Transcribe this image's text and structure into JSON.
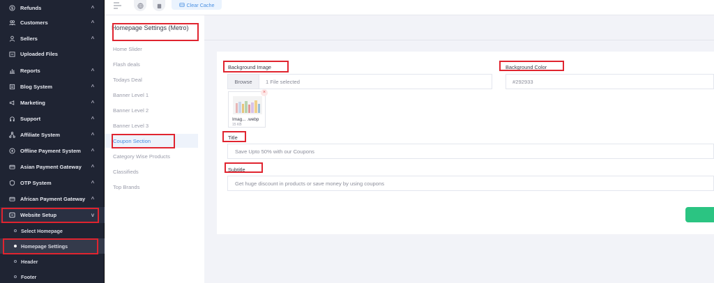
{
  "sidebar": {
    "items": [
      {
        "label": "Refunds",
        "icon": "refund-icon"
      },
      {
        "label": "Customers",
        "icon": "customers-icon"
      },
      {
        "label": "Sellers",
        "icon": "sellers-icon"
      },
      {
        "label": "Uploaded Files",
        "icon": "folder-icon"
      },
      {
        "label": "Reports",
        "icon": "chart-icon"
      },
      {
        "label": "Blog System",
        "icon": "blog-icon"
      },
      {
        "label": "Marketing",
        "icon": "megaphone-icon"
      },
      {
        "label": "Support",
        "icon": "support-icon"
      },
      {
        "label": "Affiliate System",
        "icon": "affiliate-icon"
      },
      {
        "label": "Offline Payment System",
        "icon": "offline-payment-icon"
      },
      {
        "label": "Asian Payment Gateway",
        "icon": "payment-gateway-icon"
      },
      {
        "label": "OTP System",
        "icon": "otp-icon"
      },
      {
        "label": "African Payment Gateway",
        "icon": "payment-gateway-icon"
      },
      {
        "label": "Website Setup",
        "icon": "website-icon"
      }
    ],
    "subitems": [
      {
        "label": "Select Homepage"
      },
      {
        "label": "Homepage Settings"
      },
      {
        "label": "Header"
      },
      {
        "label": "Footer"
      }
    ]
  },
  "topbar": {
    "clear_cache_label": "Clear Cache"
  },
  "settings_nav": {
    "title": "Homepage Settings (Metro)",
    "items": [
      {
        "label": "Home Slider"
      },
      {
        "label": "Flash deals"
      },
      {
        "label": "Todays Deal"
      },
      {
        "label": "Banner Level 1"
      },
      {
        "label": "Banner Level 2"
      },
      {
        "label": "Banner Level 3"
      },
      {
        "label": "Coupon Section"
      },
      {
        "label": "Category Wise Products"
      },
      {
        "label": "Classifieds"
      },
      {
        "label": "Top Brands"
      }
    ]
  },
  "form": {
    "background_image_label": "Background Image",
    "browse_label": "Browse",
    "file_selected": "1 File selected",
    "thumb_name": "Imag... .webp",
    "thumb_size": "15 KB",
    "background_color_label": "Background Color",
    "background_color_value": "#292933",
    "title_label": "Title",
    "title_value": "Save Upto 50% with our Coupons",
    "subtitle_label": "Subtitle",
    "subtitle_value": "Get huge discount in products or save money by using coupons"
  },
  "colors": {
    "sidebar_bg": "#1f2433",
    "accent": "#4a8ee0",
    "highlight": "#e0242f",
    "save_button": "#2bc482"
  }
}
